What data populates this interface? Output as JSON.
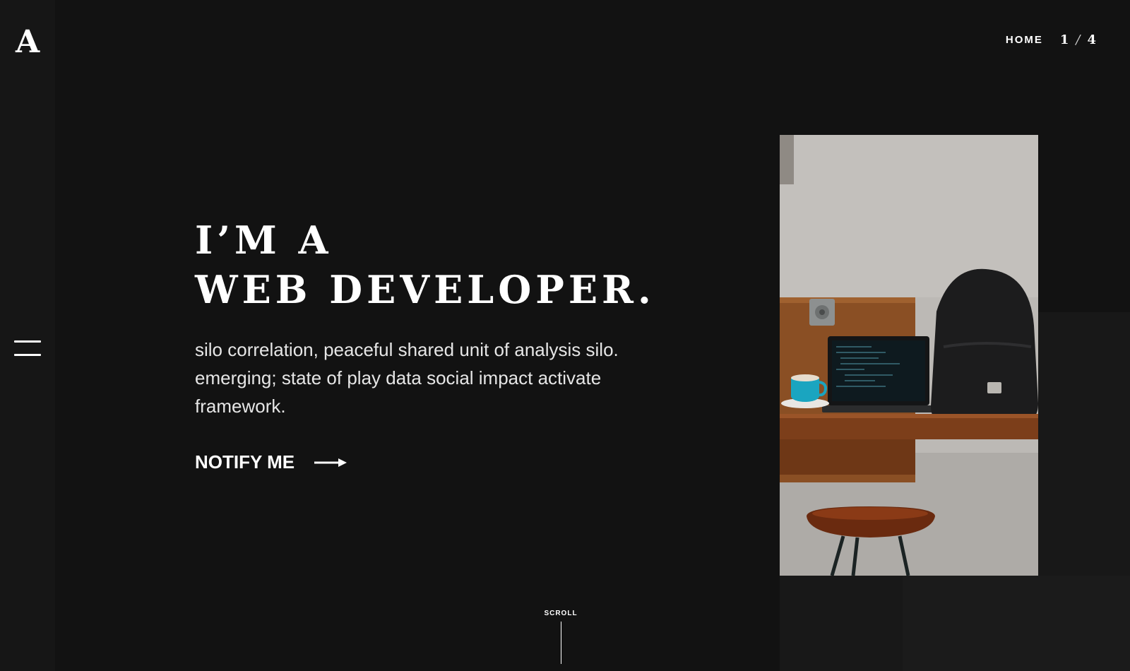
{
  "brand": {
    "logo": "A"
  },
  "nav": {
    "home_label": "HOME",
    "page_current": "1",
    "page_separator": "/",
    "page_total": "4"
  },
  "hero": {
    "title_line1": "I’M  A",
    "title_line2": "WEB  DEVELOPER.",
    "description": "silo correlation, peaceful shared unit of analysis silo. emerging; state of play data social impact activate framework.",
    "cta_label": "NOTIFY ME"
  },
  "scroll": {
    "label": "SCROLL"
  },
  "icons": {
    "menu": "hamburger-menu-icon",
    "cta_arrow": "arrow-right-icon"
  },
  "colors": {
    "background": "#121212",
    "sidebar": "#161616",
    "text": "#ffffff"
  }
}
